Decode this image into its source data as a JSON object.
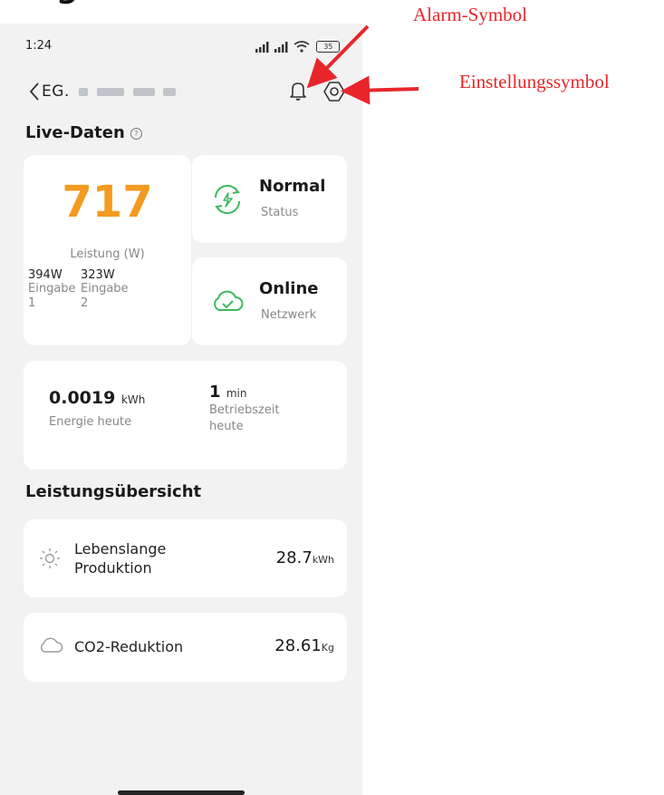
{
  "status_bar": {
    "time": "1:24",
    "battery": "35"
  },
  "header_partial_text": "g",
  "navbar": {
    "device_name": "EG."
  },
  "live_data": {
    "title": "Live-Daten",
    "power": {
      "value": "717",
      "label": "Leistung (W)"
    },
    "inputs": [
      {
        "watts": "394W",
        "label": "Eingabe 1"
      },
      {
        "watts": "323W",
        "label": "Eingabe 2"
      }
    ],
    "status": {
      "title": "Normal",
      "subtitle": "Status"
    },
    "network": {
      "title": "Online",
      "subtitle": "Netzwerk"
    },
    "energy_today": {
      "value": "0.0019",
      "unit": "kWh",
      "label": "Energie heute"
    },
    "runtime_today": {
      "value": "1",
      "unit": "min",
      "label": "Betriebszeit heute"
    }
  },
  "overview": {
    "title": "Leistungsübersicht",
    "lifetime": {
      "label": "Lebenslange Produktion",
      "value": "28.7",
      "unit": "kWh"
    },
    "co2": {
      "label": "CO2-Reduktion",
      "value": "28.61",
      "unit": "Kg"
    }
  },
  "annotations": {
    "alarm": "Alarm-Symbol",
    "settings": "Einstellungssymbol"
  },
  "colors": {
    "accent_power": "#f39a1f",
    "status_green": "#3bb95f",
    "annotation_red": "#e8262a",
    "background": "#f2f2f2"
  }
}
